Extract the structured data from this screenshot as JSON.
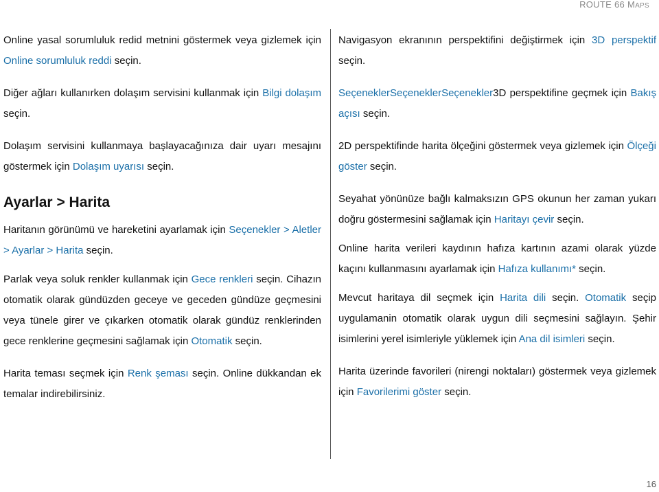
{
  "header": {
    "running_title_main": "ROUTE 66 M",
    "running_title_small": "APS"
  },
  "left_column": {
    "p1": {
      "t1": "Online yasal sorumluluk redid metnini göstermek veya gizlemek için ",
      "l1": "Online sorumluluk reddi",
      "t2": " seçin."
    },
    "p2": {
      "t1": "Diğer ağları kullanırken dolaşım servisini kullanmak için ",
      "l1": "Bilgi dolaşım",
      "t2": " seçin."
    },
    "p3": {
      "t1": "Dolaşım servisini kullanmaya başlayacağınıza dair uyarı mesajını göstermek için ",
      "l1": "Dolaşım uyarısı",
      "t2": " seçin."
    },
    "heading": "Ayarlar > Harita",
    "p4": {
      "t1": "Haritanın görünümü ve hareketini ayarlamak için ",
      "l1": "Seçenekler > Aletler > Ayarlar > Harita",
      "t2": " seçin."
    },
    "p5": {
      "t1": "Parlak veya soluk renkler kullanmak için ",
      "l1": "Gece renkleri",
      "t2": " seçin. Cihazın otomatik olarak gündüzden geceye ve geceden gündüze geçmesini veya tünele girer ve çıkarken otomatik olarak gündüz renklerinden gece renklerine geçmesini sağlamak için ",
      "l2": "Otomatik",
      "t3": " seçin."
    },
    "p6": {
      "t1": "Harita teması seçmek için ",
      "l1": "Renk şeması",
      "t2": " seçin. Online dükkandan ek temalar indirebilirsiniz."
    }
  },
  "right_column": {
    "p1": {
      "t1": "Navigasyon ekranının perspektifini değiştirmek için ",
      "l1": "3D perspektif",
      "t2": " seçin."
    },
    "p2": {
      "l1": "SeçeneklerSeçeneklerSeçenekler",
      "t1": "3D perspektifine geçmek için ",
      "l2": "Bakış açısı",
      "t2": " seçin."
    },
    "p3": {
      "t1": "2D perspektifinde harita ölçeğini göstermek veya gizlemek için ",
      "l1": "Ölçeği göster",
      "t2": " seçin."
    },
    "p4": {
      "t1": "Seyahat yönünüze bağlı kalmaksızın GPS okunun her zaman yukarı doğru göstermesini sağlamak için ",
      "l1": "Haritayı çevir",
      "t2": " seçin."
    },
    "p5": {
      "t1": "Online harita verileri kaydının hafıza kartının azami olarak yüzde kaçını kullanmasını ayarlamak için ",
      "l1": "Hafıza kullanımı*",
      "t2": " seçin."
    },
    "p6": {
      "t1": "Mevcut haritaya dil seçmek için ",
      "l1": "Harita dili",
      "t2": " seçin. ",
      "l2": "Otomatik",
      "t3": " seçip uygulamanin otomatik olarak uygun dili seçmesini sağlayın. Şehir isimlerini yerel isimleriyle yüklemek için ",
      "l3": "Ana dil isimleri",
      "t4": " seçin."
    },
    "p7": {
      "t1": "Harita üzerinde favorileri (nirengi noktaları) göstermek veya gizlemek için ",
      "l1": "Favorilerimi göster",
      "t2": " seçin."
    }
  },
  "footer": {
    "page_number": "16"
  },
  "colors": {
    "link": "#1a6fa8",
    "text": "#111111",
    "running_head": "#8a8a8a"
  }
}
